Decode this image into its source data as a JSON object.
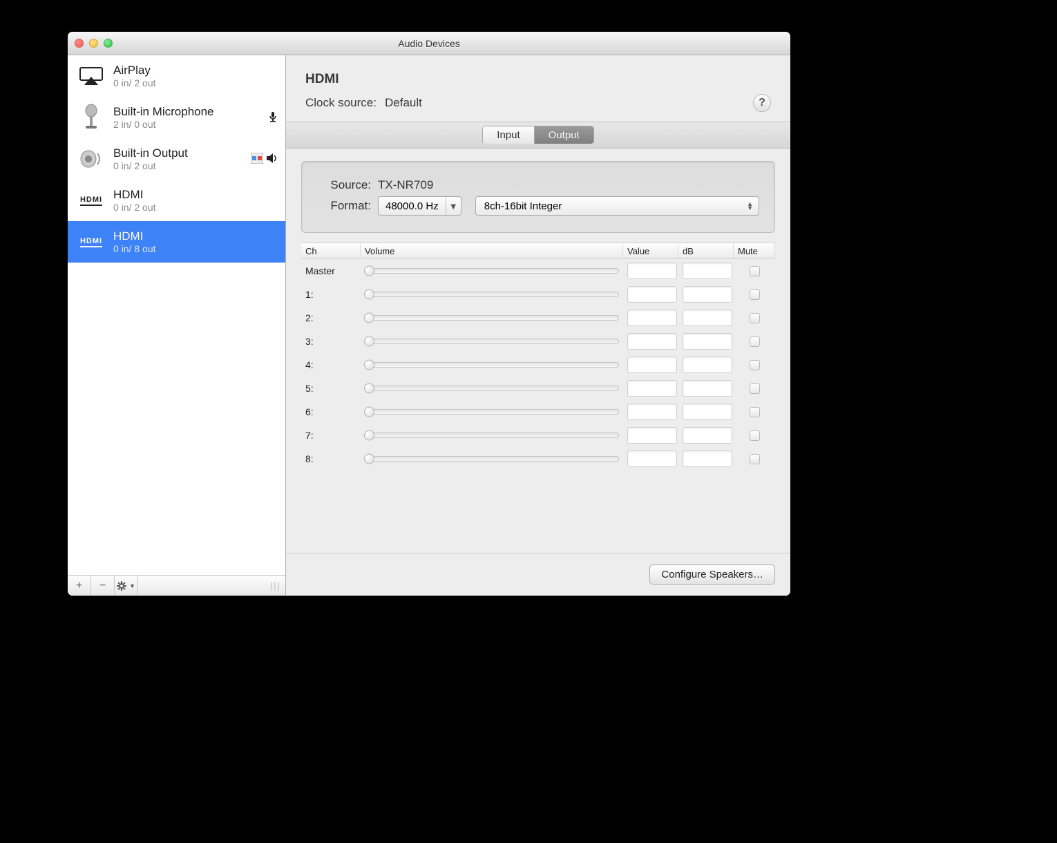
{
  "window": {
    "title": "Audio Devices"
  },
  "sidebar": {
    "devices": [
      {
        "name": "AirPlay",
        "spec": "0 in/ 2 out",
        "icon": "airplay"
      },
      {
        "name": "Built-in Microphone",
        "spec": "2 in/ 0 out",
        "icon": "microphone",
        "badges": [
          "mic"
        ]
      },
      {
        "name": "Built-in Output",
        "spec": "0 in/ 2 out",
        "icon": "speaker",
        "badges": [
          "finder",
          "sound"
        ]
      },
      {
        "name": "HDMI",
        "spec": "0 in/ 2 out",
        "icon": "hdmi"
      },
      {
        "name": "HDMI",
        "spec": "0 in/ 8 out",
        "icon": "hdmi",
        "selected": true
      }
    ],
    "footer": {
      "add": "+",
      "remove": "−"
    }
  },
  "detail": {
    "title": "HDMI",
    "clock_label": "Clock source:",
    "clock_value": "Default",
    "tabs": {
      "input": "Input",
      "output": "Output",
      "active": "output"
    },
    "source_label": "Source:",
    "source_value": "TX-NR709",
    "format_label": "Format:",
    "format_rate": "48000.0 Hz",
    "format_depth": "8ch-16bit Integer",
    "table": {
      "headers": {
        "ch": "Ch",
        "volume": "Volume",
        "value": "Value",
        "db": "dB",
        "mute": "Mute"
      },
      "rows": [
        {
          "ch": "Master"
        },
        {
          "ch": "1:"
        },
        {
          "ch": "2:"
        },
        {
          "ch": "3:"
        },
        {
          "ch": "4:"
        },
        {
          "ch": "5:"
        },
        {
          "ch": "6:"
        },
        {
          "ch": "7:"
        },
        {
          "ch": "8:"
        }
      ]
    },
    "configure_label": "Configure Speakers…"
  },
  "help_tooltip": "?"
}
